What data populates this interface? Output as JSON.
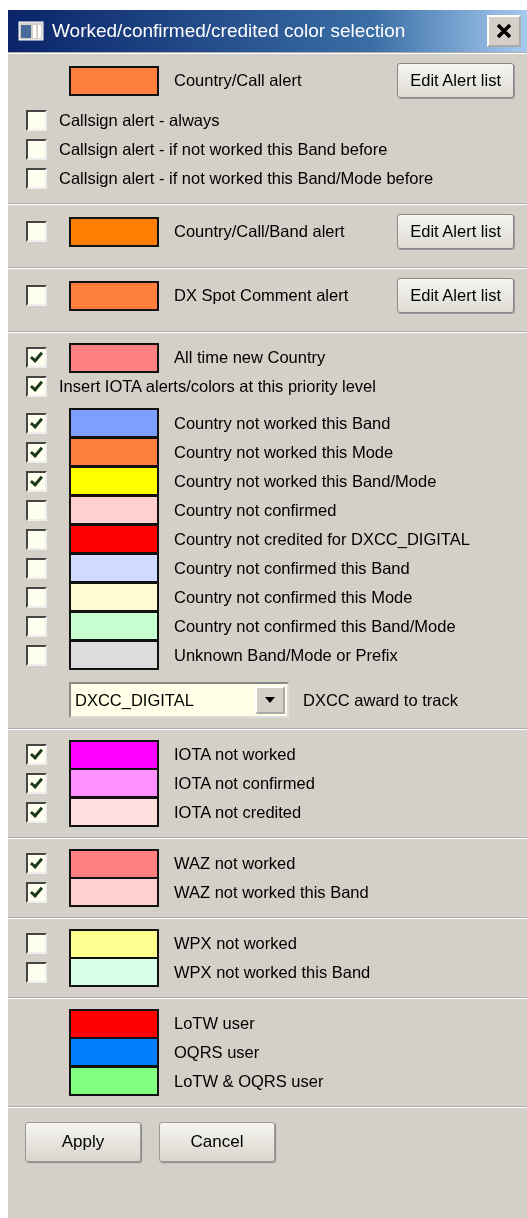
{
  "window": {
    "title": "Worked/confirmed/credited color selection"
  },
  "sections": [
    {
      "rows": [
        {
          "kind": "swatch",
          "color": "#ff7f3f",
          "label": "Country/Call alert",
          "button": "Edit Alert list"
        },
        {
          "kind": "check",
          "checked": false,
          "label": "Callsign alert - always"
        },
        {
          "kind": "check",
          "checked": false,
          "label": "Callsign alert - if not worked this Band before"
        },
        {
          "kind": "check",
          "checked": false,
          "label": "Callsign alert - if not worked this Band/Mode before"
        }
      ]
    },
    {
      "rows": [
        {
          "kind": "swatch",
          "checked": false,
          "color": "#ff8000",
          "label": "Country/Call/Band alert",
          "button": "Edit Alert list"
        }
      ]
    },
    {
      "rows": [
        {
          "kind": "swatch",
          "checked": false,
          "color": "#ff7f3f",
          "label": "DX Spot Comment alert",
          "button": "Edit Alert list"
        }
      ]
    },
    {
      "rows": [
        {
          "kind": "swatch",
          "checked": true,
          "color": "#ff8080",
          "label": "All time new Country"
        },
        {
          "kind": "check",
          "checked": true,
          "label": "Insert IOTA alerts/colors at this priority level"
        },
        {
          "kind": "swatch",
          "checked": true,
          "color": "#7f9fff",
          "label": "Country not worked this Band"
        },
        {
          "kind": "swatch",
          "checked": true,
          "color": "#ff7f3f",
          "label": "Country not worked this Mode"
        },
        {
          "kind": "swatch",
          "checked": true,
          "color": "#ffff00",
          "label": "Country not worked this Band/Mode"
        },
        {
          "kind": "swatch",
          "checked": false,
          "color": "#ffd0d0",
          "label": "Country not confirmed"
        },
        {
          "kind": "swatch",
          "checked": false,
          "color": "#ff0000",
          "label": "Country not credited for DXCC_DIGITAL"
        },
        {
          "kind": "swatch",
          "checked": false,
          "color": "#d0dcff",
          "label": "Country not confirmed this Band"
        },
        {
          "kind": "swatch",
          "checked": false,
          "color": "#fffad0",
          "label": "Country not confirmed this Mode"
        },
        {
          "kind": "swatch",
          "checked": false,
          "color": "#c8ffd0",
          "label": "Country not confirmed this Band/Mode"
        },
        {
          "kind": "swatch",
          "checked": false,
          "color": "#dcdcdc",
          "label": "Unknown Band/Mode or Prefix"
        },
        {
          "kind": "dropdown",
          "award": "DXCC_DIGITAL",
          "caption": "DXCC award to track"
        }
      ]
    },
    {
      "rows": [
        {
          "kind": "swatch",
          "checked": true,
          "color": "#ff00ff",
          "label": "IOTA not worked"
        },
        {
          "kind": "swatch",
          "checked": true,
          "color": "#ff90ff",
          "label": "IOTA not confirmed"
        },
        {
          "kind": "swatch",
          "checked": true,
          "color": "#ffdede",
          "label": "IOTA not credited"
        }
      ]
    },
    {
      "rows": [
        {
          "kind": "swatch",
          "checked": true,
          "color": "#ff8080",
          "label": "WAZ not worked"
        },
        {
          "kind": "swatch",
          "checked": true,
          "color": "#ffd0d0",
          "label": "WAZ not worked this Band"
        }
      ]
    },
    {
      "rows": [
        {
          "kind": "swatch",
          "checked": false,
          "color": "#ffff90",
          "label": "WPX not worked"
        },
        {
          "kind": "swatch",
          "checked": false,
          "color": "#d8ffe8",
          "label": "WPX not worked this Band"
        }
      ]
    },
    {
      "rows": [
        {
          "kind": "swatch",
          "color": "#ff0000",
          "label": "LoTW user"
        },
        {
          "kind": "swatch",
          "color": "#0080ff",
          "label": "OQRS user"
        },
        {
          "kind": "swatch",
          "color": "#80ff80",
          "label": "LoTW & OQRS user"
        }
      ]
    }
  ],
  "buttons": [
    "Apply",
    "Cancel"
  ]
}
